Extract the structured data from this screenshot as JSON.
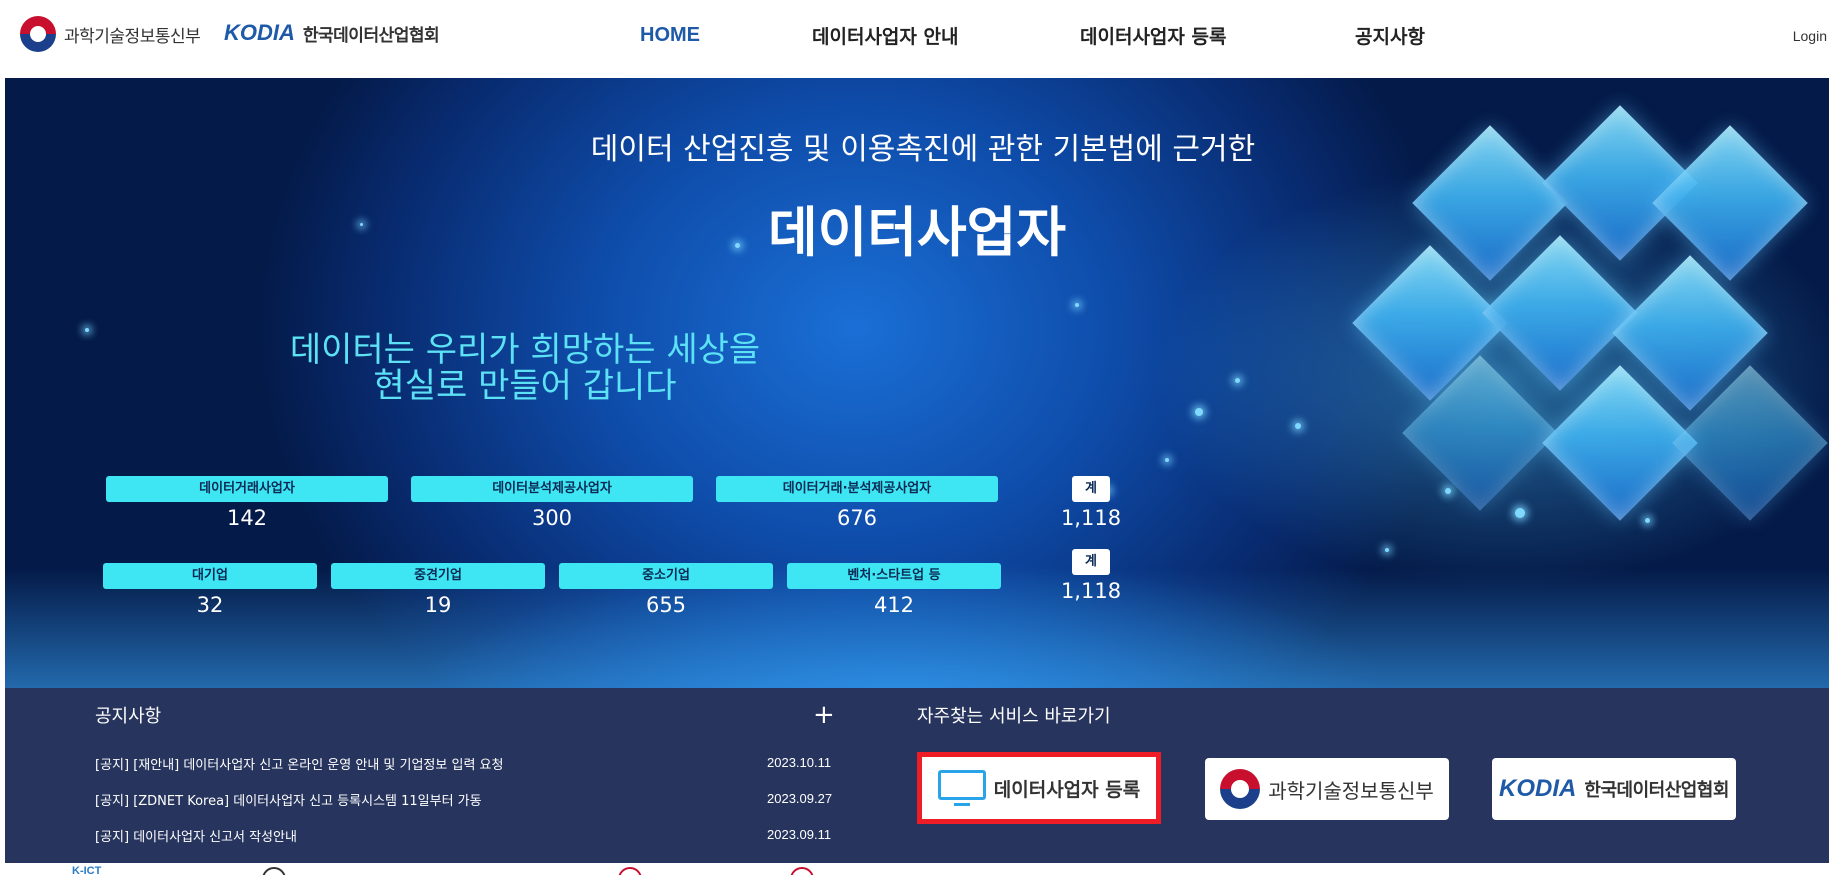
{
  "header": {
    "gov_logo_text": "과학기술정보통신부",
    "kodia_mark": "KODIA",
    "kodia_name": "한국데이터산업협회",
    "nav": [
      "HOME",
      "데이터사업자 안내",
      "데이터사업자 등록",
      "공지사항"
    ],
    "login": "Login"
  },
  "hero": {
    "subtitle": "데이터 산업진흥 및 이용촉진에 관한 기본법에 근거한",
    "title": "데이터사업자",
    "slogan_line1": "데이터는 우리가 희망하는 세상을",
    "slogan_line2": "현실로 만들어 갑니다",
    "stats_row1": [
      {
        "label": "데이터거래사업자",
        "value": "142"
      },
      {
        "label": "데이터분석제공사업자",
        "value": "300"
      },
      {
        "label": "데이터거래·분석제공사업자",
        "value": "676"
      }
    ],
    "total_row1": {
      "label": "계",
      "value": "1,118"
    },
    "stats_row2": [
      {
        "label": "대기업",
        "value": "32"
      },
      {
        "label": "중견기업",
        "value": "19"
      },
      {
        "label": "중소기업",
        "value": "655"
      },
      {
        "label": "벤처·스타트업 등",
        "value": "412"
      }
    ],
    "total_row2": {
      "label": "계",
      "value": "1,118"
    }
  },
  "notices": {
    "title": "공지사항",
    "more": "+",
    "items": [
      {
        "text": "[공지] [재안내] 데이터사업자 신고 온라인 운영 안내 및 기업정보 입력 요청",
        "date": "2023.10.11"
      },
      {
        "text": "[공지] [ZDNET Korea] 데이터사업자 신고 등록시스템 11일부터 가동",
        "date": "2023.09.27"
      },
      {
        "text": "[공지] 데이터사업자 신고서 작성안내",
        "date": "2023.09.11"
      }
    ]
  },
  "services": {
    "title": "자주찾는 서비스 바로가기",
    "register_label": "데이터사업자 등록",
    "gov_label": "과학기술정보통신부",
    "kodia_mark": "KODIA",
    "kodia_label": "한국데이터산업협회"
  },
  "partners": {
    "first": "K-ICT"
  },
  "colors": {
    "nav_active": "#1e5aa8",
    "stat_label_bg": "#3ee5f3",
    "slogan": "#5ce1f5",
    "band_bg": "#27355e",
    "highlight_border": "#ee1c24"
  }
}
